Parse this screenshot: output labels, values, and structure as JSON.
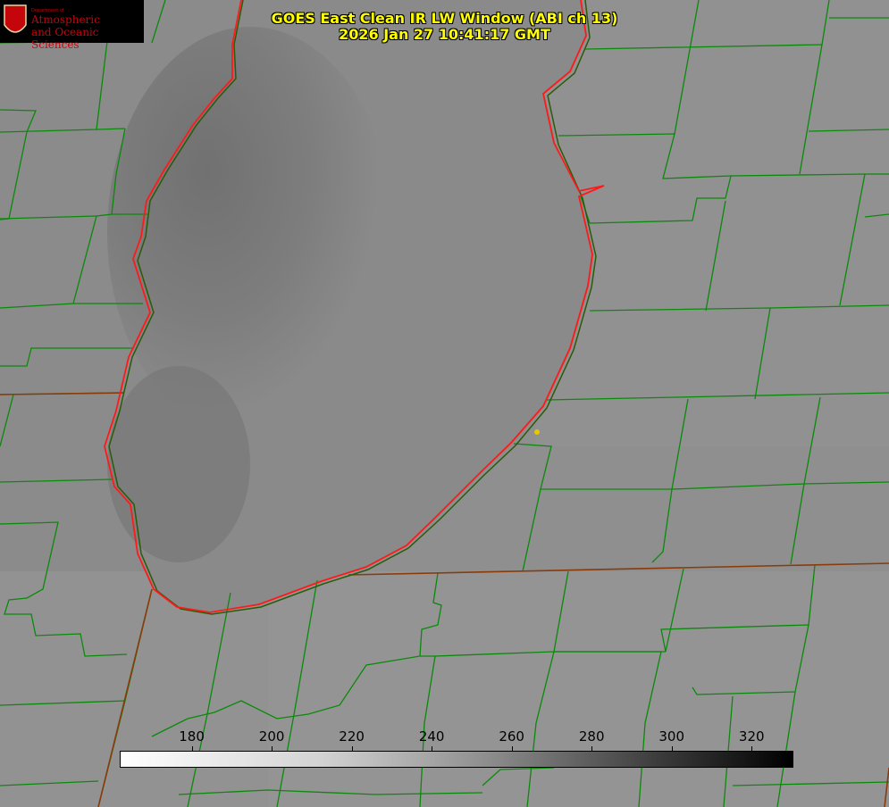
{
  "title": {
    "line1": "GOES East Clean IR LW Window (ABI ch 13)",
    "line2": "2026 Jan 27 10:41:17 GMT"
  },
  "logo": {
    "dept": "Department of",
    "line1": "Atmospheric",
    "line2": "and Oceanic Sciences",
    "seal_letter": "W"
  },
  "colorbar": {
    "ticks": [
      "180",
      "200",
      "220",
      "240",
      "260",
      "280",
      "300",
      "320"
    ],
    "range": [
      162,
      330
    ]
  },
  "colors": {
    "county_lines": "#0a8a0a",
    "state_lines": "#8b3a0a",
    "lake_outline": "#ff1a1a",
    "text": "#ffff00",
    "marker": "#e6c800"
  }
}
